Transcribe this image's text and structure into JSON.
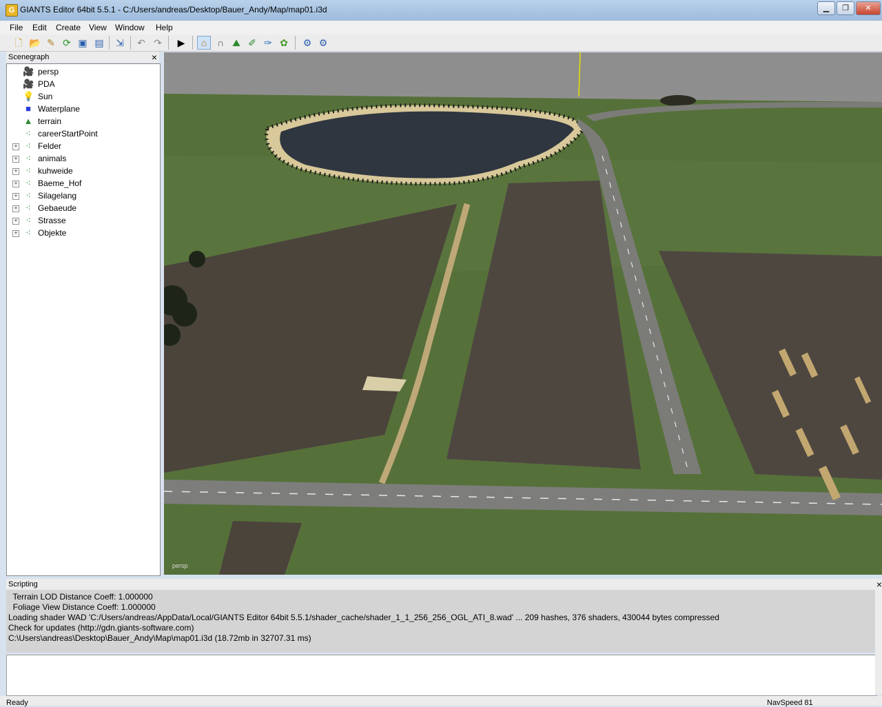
{
  "window": {
    "title": "GIANTS Editor 64bit 5.5.1 - C:/Users/andreas/Desktop/Bauer_Andy/Map/map01.i3d",
    "app_icon": "G"
  },
  "menu": [
    "File",
    "Edit",
    "Create",
    "View",
    "Window",
    "Help"
  ],
  "toolbar": {
    "buttons": [
      "new-file-icon",
      "open-folder-icon",
      "edit-file-icon",
      "reload-icon",
      "save-icon",
      "save-as-icon",
      "import-icon",
      "undo-icon",
      "redo-icon",
      "play-icon",
      "home-camera-icon",
      "magnet-icon",
      "terrain-sculpt-icon",
      "terrain-paint-icon",
      "foliage-paint-icon",
      "foliage-tool-icon",
      "settings-gear-icon",
      "gear-refresh-icon"
    ]
  },
  "scenegraph": {
    "title": "Scenegraph",
    "close": "×",
    "nodes": [
      {
        "label": "persp",
        "icon": "camera-icon",
        "expandable": false
      },
      {
        "label": "PDA",
        "icon": "camera-icon",
        "expandable": false
      },
      {
        "label": "Sun",
        "icon": "light-bulb-icon",
        "expandable": false
      },
      {
        "label": "Waterplane",
        "icon": "cube-icon",
        "expandable": false
      },
      {
        "label": "terrain",
        "icon": "terrain-icon",
        "expandable": false
      },
      {
        "label": "careerStartPoint",
        "icon": "transform-group-icon",
        "expandable": false
      },
      {
        "label": "Felder",
        "icon": "transform-group-icon",
        "expandable": true
      },
      {
        "label": "animals",
        "icon": "transform-group-icon",
        "expandable": true
      },
      {
        "label": "kuhweide",
        "icon": "transform-group-icon",
        "expandable": true
      },
      {
        "label": "Baeme_Hof",
        "icon": "transform-group-icon",
        "expandable": true
      },
      {
        "label": "Silagelang",
        "icon": "transform-group-icon",
        "expandable": true
      },
      {
        "label": "Gebaeude",
        "icon": "transform-group-icon",
        "expandable": true
      },
      {
        "label": "Strasse",
        "icon": "transform-group-icon",
        "expandable": true
      },
      {
        "label": "Objekte",
        "icon": "transform-group-icon",
        "expandable": true
      }
    ]
  },
  "viewport": {
    "camera_label": "persp"
  },
  "scripting": {
    "title": "Scripting",
    "close": "×",
    "lines": [
      "  Terrain LOD Distance Coeff: 1.000000",
      "  Foliage View Distance Coeff: 1.000000",
      "Loading shader WAD 'C:/Users/andreas/AppData/Local/GIANTS Editor 64bit 5.5.1/shader_cache/shader_1_1_256_256_OGL_ATI_8.wad' ... 209 hashes, 376 shaders, 430044 bytes compressed",
      "Check for updates (http://gdn.giants-software.com)",
      "C:\\Users\\andreas\\Desktop\\Bauer_Andy\\Map\\map01.i3d (18.72mb in 32707.31 ms)"
    ]
  },
  "status": {
    "left": "Ready",
    "right": "NavSpeed 81"
  }
}
